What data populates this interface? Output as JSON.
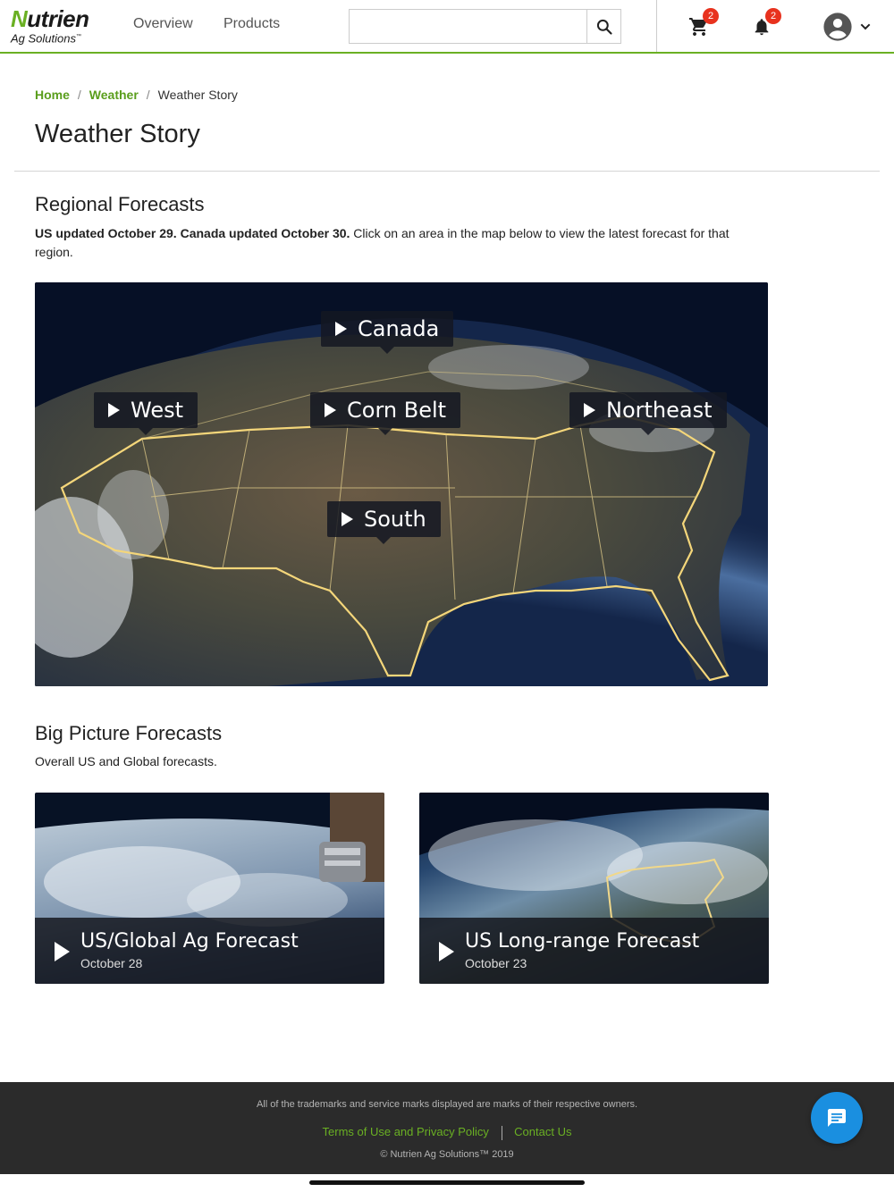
{
  "header": {
    "logo_name": "Nutrien",
    "logo_sub": "Ag Solutions",
    "nav": [
      "Overview",
      "Products"
    ],
    "search_placeholder": "",
    "cart_count": "2",
    "notification_count": "2",
    "accent_color": "#6ab023"
  },
  "breadcrumb": {
    "items": [
      "Home",
      "Weather"
    ],
    "current": "Weather Story",
    "separator": "/"
  },
  "page_title": "Weather Story",
  "regional": {
    "heading": "Regional Forecasts",
    "intro_bold": "US updated October 29. Canada updated October 30.",
    "intro_rest": " Click on an area in the map below to view the latest forecast for that region.",
    "regions": [
      "Canada",
      "West",
      "Corn Belt",
      "Northeast",
      "South"
    ]
  },
  "big_picture": {
    "heading": "Big Picture Forecasts",
    "intro": "Overall US and Global forecasts.",
    "cards": [
      {
        "title": "US/Global Ag Forecast",
        "date": "October 28"
      },
      {
        "title": "US Long-range Forecast",
        "date": "October 23"
      }
    ]
  },
  "footer": {
    "note": "All of the trademarks and service marks displayed are marks of their respective owners.",
    "links": [
      "Terms of Use and Privacy Policy",
      "Contact Us"
    ],
    "copyright": "© Nutrien Ag Solutions™ 2019"
  },
  "icons": {
    "search": "search-icon",
    "cart": "cart-icon",
    "bell": "bell-icon",
    "account": "account-icon",
    "chevron": "chevron-down-icon",
    "chat": "chat-icon",
    "play": "play-icon"
  }
}
